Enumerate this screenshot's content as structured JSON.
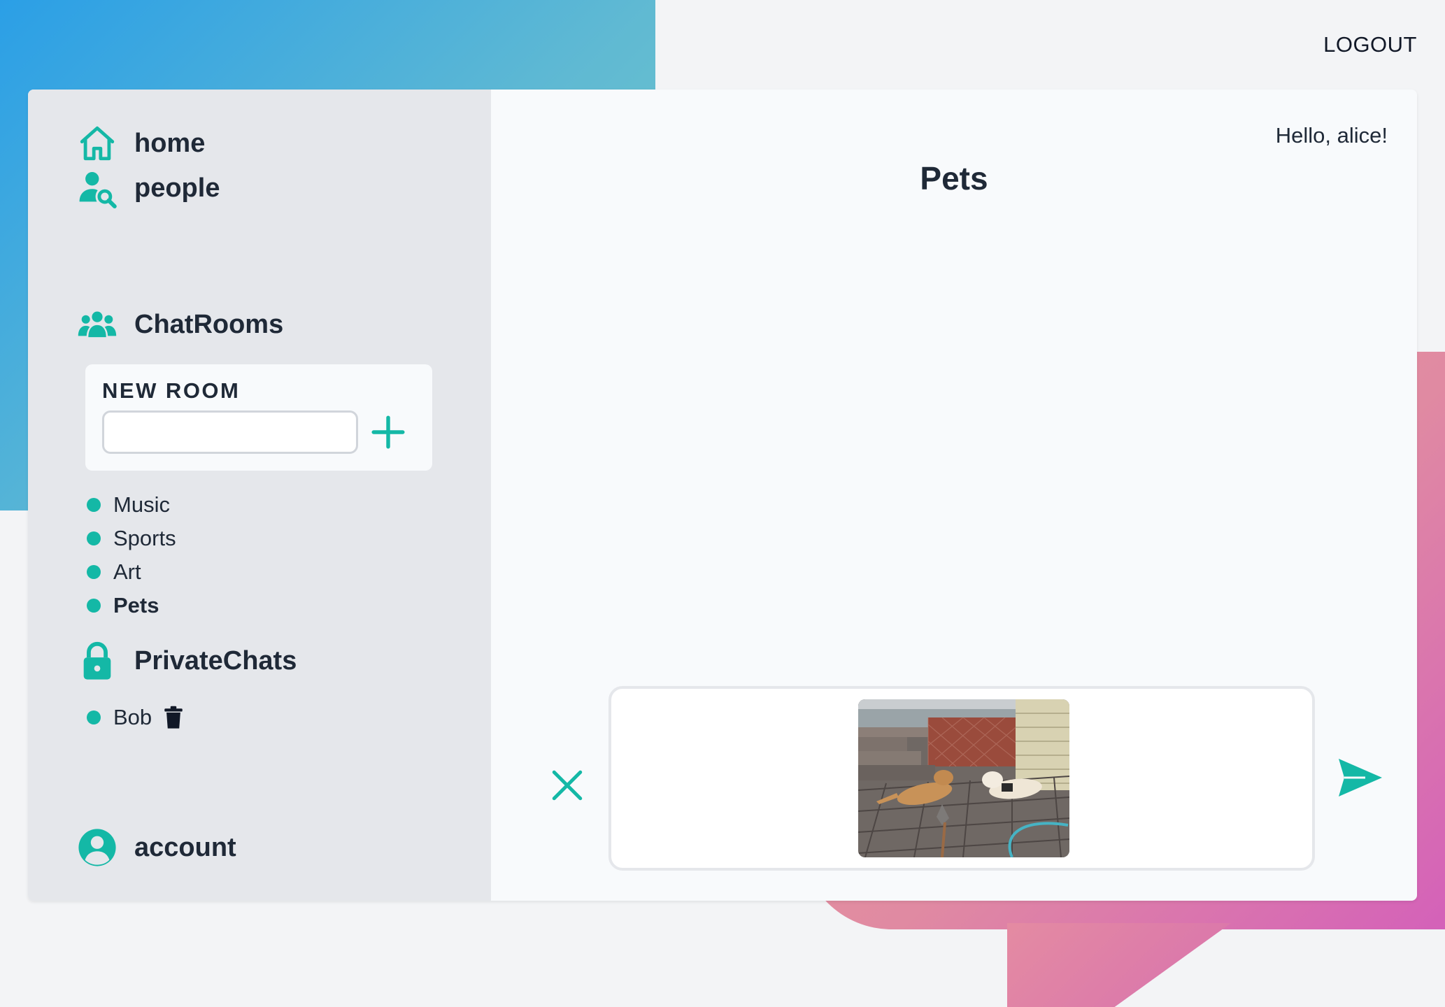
{
  "header": {
    "logout_label": "LOGOUT"
  },
  "sidebar": {
    "nav": [
      {
        "label": "home",
        "icon": "home-icon"
      },
      {
        "label": "people",
        "icon": "people-search-icon"
      }
    ],
    "chatrooms": {
      "heading": "ChatRooms",
      "icon": "group-icon",
      "new_room_label": "NEW ROOM",
      "new_room_value": "",
      "rooms": [
        {
          "label": "Music",
          "active": false
        },
        {
          "label": "Sports",
          "active": false
        },
        {
          "label": "Art",
          "active": false
        },
        {
          "label": "Pets",
          "active": true
        }
      ]
    },
    "private_chats": {
      "heading": "PrivateChats",
      "icon": "lock-icon",
      "chats": [
        {
          "label": "Bob"
        }
      ]
    },
    "account": {
      "label": "account",
      "icon": "user-circle-icon"
    }
  },
  "main": {
    "greeting": "Hello, alice!",
    "room_title": "Pets",
    "composer": {
      "attachment": "image-preview"
    }
  },
  "colors": {
    "accent": "#14b8a6",
    "sidebar_bg": "#e5e7eb",
    "card_bg": "#f8fafc",
    "text": "#1f2937"
  }
}
